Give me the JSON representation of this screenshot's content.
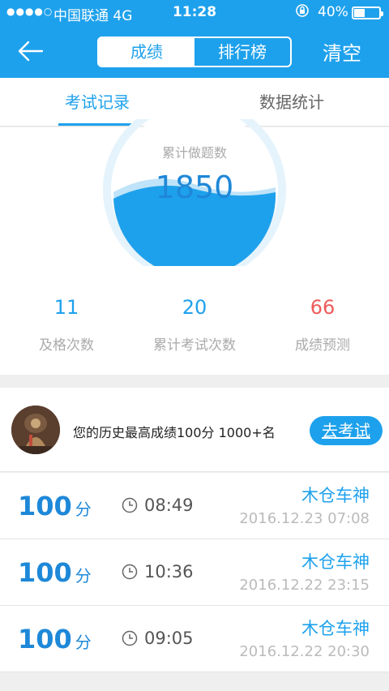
{
  "status_bar": {
    "signal": "●●●●○",
    "carrier": "中国联通   4G",
    "time": "11:28",
    "battery_percent": "40%"
  },
  "nav": {
    "segments": [
      "成绩",
      "排行榜"
    ],
    "active_segment": "成绩",
    "clear_label": "清空"
  },
  "tabs": [
    "考试记录",
    "数据统计"
  ],
  "summary": {
    "gauge_label": "累计做题数",
    "gauge_value": "1850",
    "stats": [
      {
        "value": "11",
        "label": "及格次数"
      },
      {
        "value": "20",
        "label": "累计考试次数"
      },
      {
        "value": "66",
        "label": "成绩预测"
      }
    ]
  },
  "profile": {
    "text": "您的历史最高成绩100分  1000+名",
    "button_label": "去考试"
  },
  "records": [
    {
      "score": "100",
      "unit": "分",
      "duration": "08:49",
      "name": "木仓车神",
      "date": "2016.12.23 07:08"
    },
    {
      "score": "100",
      "unit": "分",
      "duration": "10:36",
      "name": "木仓车神",
      "date": "2016.12.22 23:15"
    },
    {
      "score": "100",
      "unit": "分",
      "duration": "09:05",
      "name": "木仓车神",
      "date": "2016.12.22 20:30"
    }
  ],
  "colors": {
    "accent": "#1ea1ec",
    "score_blue": "#1e88d8",
    "prediction_red": "#ef5b5b"
  }
}
